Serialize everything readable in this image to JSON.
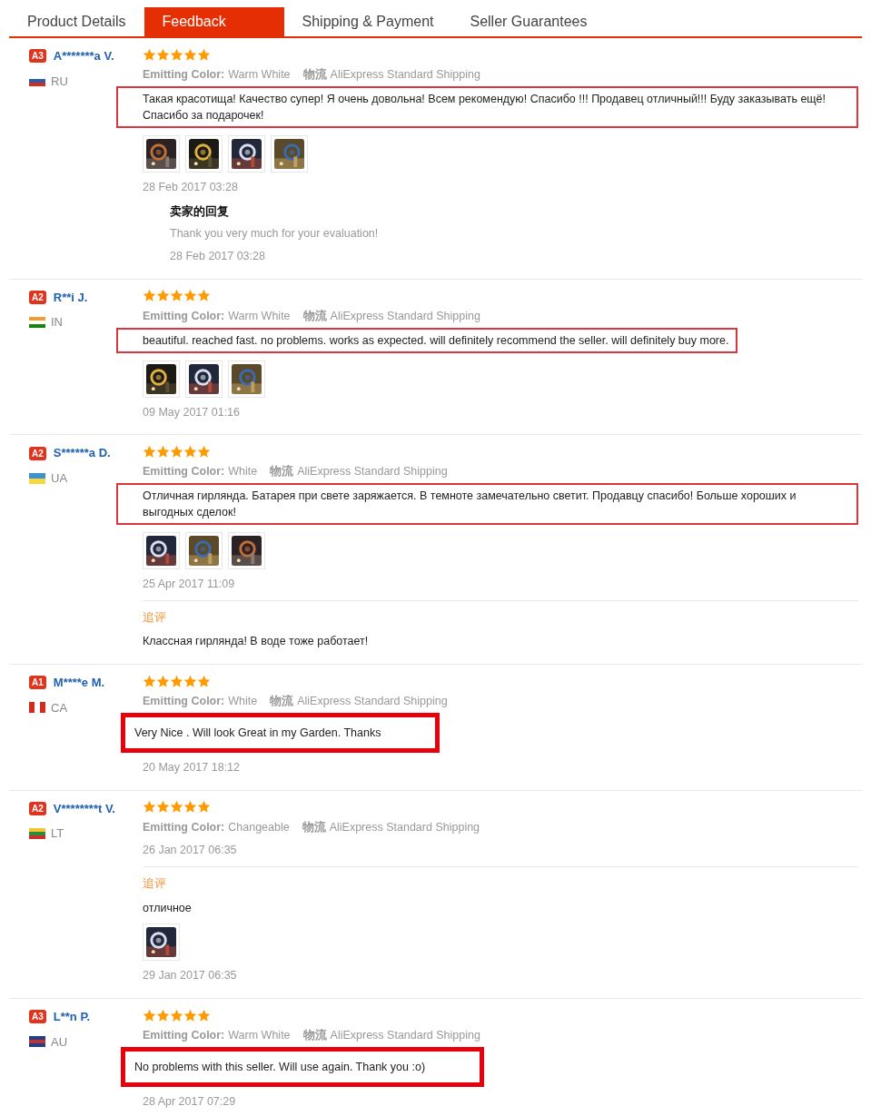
{
  "tabs": [
    {
      "label": "Product Details",
      "selected": false
    },
    {
      "label": "Feedback",
      "selected": true
    },
    {
      "label": "Shipping & Payment",
      "selected": false
    },
    {
      "label": "Seller Guarantees",
      "selected": false
    }
  ],
  "reviews": [
    {
      "level": "A3",
      "name": "A*******a V.",
      "country": "RU",
      "flag": {
        "kind": "rows",
        "stripes": [
          {
            "color": "#ffffff"
          },
          {
            "color": "#2a5db0"
          },
          {
            "color": "#d52b1e"
          }
        ]
      },
      "stars": 5,
      "attributes": [
        {
          "label": "Emitting Color:",
          "value": "Warm White"
        },
        {
          "label": "物流",
          "value": "AliExpress Standard Shipping"
        }
      ],
      "text": "Такая красотища! Качество супер! Я очень довольна! Всем рекомендую! Спасибо !!! Продавец отличный!!! Буду заказывать ещё! Спасибо за подарочек!",
      "kind": "thin",
      "photos": [
        {
          "kind": "picture"
        },
        {
          "kind": "picture"
        },
        {
          "kind": "picture"
        },
        {
          "kind": "picture"
        }
      ],
      "date": "28 Feb 2017 03:28",
      "reply": {
        "title": "卖家的回复",
        "text": "Thank you very much for your evaluation!",
        "date": "28 Feb 2017 03:28"
      }
    },
    {
      "level": "A2",
      "name": "R**i J.",
      "country": "IN",
      "flag": {
        "kind": "rows",
        "stripes": [
          {
            "color": "#f39c33"
          },
          {
            "color": "#ffffff"
          },
          {
            "color": "#138808"
          }
        ]
      },
      "stars": 5,
      "attributes": [
        {
          "label": "Emitting Color:",
          "value": "Warm White"
        },
        {
          "label": "物流",
          "value": "AliExpress Standard Shipping"
        }
      ],
      "text": "beautiful. reached fast. no problems. works as expected. will definitely recommend the seller. will definitely buy more.",
      "kind": "thin",
      "photos": [
        {
          "kind": "picture"
        },
        {
          "kind": "picture"
        },
        {
          "kind": "picture"
        }
      ],
      "date": "09 May 2017 01:16"
    },
    {
      "level": "A2",
      "name": "S******a D.",
      "country": "UA",
      "flag": {
        "kind": "rows",
        "stripes": [
          {
            "color": "#3d8fd6"
          },
          {
            "color": "#f7d83a"
          }
        ]
      },
      "stars": 5,
      "attributes": [
        {
          "label": "Emitting Color:",
          "value": "White"
        },
        {
          "label": "物流",
          "value": "AliExpress Standard Shipping"
        }
      ],
      "text": "Отличная гирлянда. Батарея при свете заряжается. В темноте замечательно светит. Продавцу спасибо! Больше хороших и выгодных сделок!",
      "kind": "thin",
      "photos": [
        {
          "kind": "picture"
        },
        {
          "kind": "picture"
        },
        {
          "kind": "picture"
        }
      ],
      "date": "25 Apr 2017 11:09",
      "followup": {
        "title": "追评",
        "text": "Классная гирлянда! В воде тоже работает!"
      }
    },
    {
      "level": "A1",
      "name": "M****e M.",
      "country": "CA",
      "flag": {
        "kind": "columns",
        "stripes": [
          {
            "color": "#d52b1e"
          },
          {
            "color": "#ffffff"
          },
          {
            "color": "#d52b1e"
          }
        ]
      },
      "stars": 5,
      "attributes": [
        {
          "label": "Emitting Color:",
          "value": "White"
        },
        {
          "label": "物流",
          "value": "AliExpress Standard Shipping"
        }
      ],
      "text": "Very Nice . Will look Great in my Garden. Thanks",
      "kind": "thick",
      "date": "20 May 2017 18:12"
    },
    {
      "level": "A2",
      "name": "V********t V.",
      "country": "LT",
      "flag": {
        "kind": "rows",
        "stripes": [
          {
            "color": "#f2c530"
          },
          {
            "color": "#2f8a3c"
          },
          {
            "color": "#c8312b"
          }
        ]
      },
      "stars": 5,
      "attributes": [
        {
          "label": "Emitting Color:",
          "value": "Changeable"
        },
        {
          "label": "物流",
          "value": "AliExpress Standard Shipping"
        }
      ],
      "date": "26 Jan 2017 06:35",
      "followup": {
        "title": "追评",
        "text": "отличное",
        "photos": [
          {
            "kind": "picture"
          }
        ],
        "date": "29 Jan 2017 06:35"
      }
    },
    {
      "level": "A3",
      "name": "L**n P.",
      "country": "AU",
      "flag": {
        "kind": "rows",
        "stripes": [
          {
            "color": "#1f3f8f"
          },
          {
            "color": "#c8312b"
          },
          {
            "color": "#1f3f8f"
          }
        ]
      },
      "stars": 5,
      "attributes": [
        {
          "label": "Emitting Color:",
          "value": "Warm White"
        },
        {
          "label": "物流",
          "value": "AliExpress Standard Shipping"
        }
      ],
      "text": "No problems with this seller. Will use again. Thank you :o)",
      "kind": "thick",
      "date": "28 Apr 2017 07:29"
    }
  ]
}
